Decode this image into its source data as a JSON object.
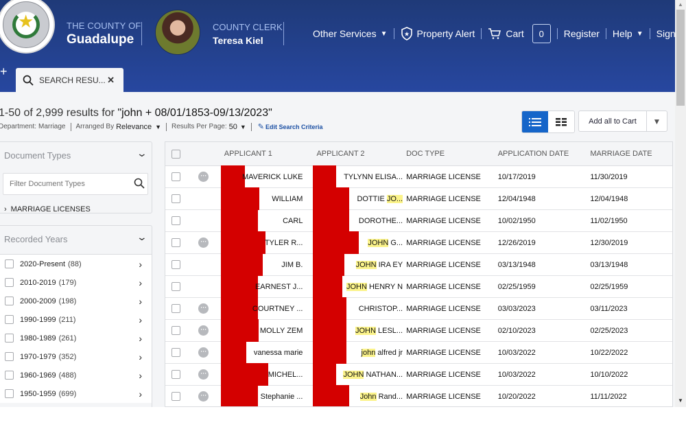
{
  "header": {
    "county_prefix": "THE COUNTY OF",
    "county_name": "Guadalupe",
    "clerk_title": "COUNTY CLERK",
    "clerk_name": "Teresa Kiel",
    "nav": {
      "other_services": "Other Services",
      "property_alert": "Property Alert",
      "cart": "Cart",
      "cart_count": "0",
      "register": "Register",
      "help": "Help",
      "sign_in": "Sign In"
    },
    "new_tab": "+",
    "tab_label": "SEARCH RESU..."
  },
  "results": {
    "summary_prefix": "1-50 of 2,999 results for",
    "query": "\"john + 08/01/1853-09/13/2023\"",
    "department_label": "Department:",
    "department_value": "Marriage",
    "arranged_label": "Arranged By",
    "arranged_value": "Relevance",
    "per_page_label": "Results Per Page:",
    "per_page_value": "50",
    "edit_criteria": "Edit Search Criteria",
    "add_all_to_cart": "Add all to Cart"
  },
  "sidebar": {
    "doc_types": {
      "title": "Document Types",
      "filter_placeholder": "Filter Document Types",
      "item": "MARRIAGE LICENSES"
    },
    "years": {
      "title": "Recorded Years",
      "items": [
        {
          "label": "2020-Present",
          "count": "(88)"
        },
        {
          "label": "2010-2019",
          "count": "(179)"
        },
        {
          "label": "2000-2009",
          "count": "(198)"
        },
        {
          "label": "1990-1999",
          "count": "(211)"
        },
        {
          "label": "1980-1989",
          "count": "(261)"
        },
        {
          "label": "1970-1979",
          "count": "(352)"
        },
        {
          "label": "1960-1969",
          "count": "(488)"
        },
        {
          "label": "1950-1959",
          "count": "(699)"
        }
      ]
    }
  },
  "table": {
    "headers": [
      "APPLICANT 1",
      "APPLICANT 2",
      "DOC TYPE",
      "APPLICATION DATE",
      "MARRIAGE DATE"
    ],
    "rows": [
      {
        "more": true,
        "a1": "MAVERICK LUKE",
        "a2_hl": "",
        "a2": "TYLYNN ELISA...",
        "doc": "MARRIAGE LICENSE",
        "app": "10/17/2019",
        "mar": "11/30/2019"
      },
      {
        "more": false,
        "a1": "WILLIAM",
        "a2_pre": "DOTTIE ",
        "a2_hl": "JO...",
        "a2": "",
        "doc": "MARRIAGE LICENSE",
        "app": "12/04/1948",
        "mar": "12/04/1948"
      },
      {
        "more": false,
        "a1": "CARL",
        "a2_hl": "",
        "a2": "DOROTHE...",
        "doc": "MARRIAGE LICENSE",
        "app": "10/02/1950",
        "mar": "11/02/1950"
      },
      {
        "more": true,
        "a1": "TYLER R...",
        "a2_hl": "JOHN",
        "a2": " G...",
        "doc": "MARRIAGE LICENSE",
        "app": "12/26/2019",
        "mar": "12/30/2019"
      },
      {
        "more": false,
        "a1": "JIM B.",
        "a2_hl": "JOHN",
        "a2": " IRA EY",
        "doc": "MARRIAGE LICENSE",
        "app": "03/13/1948",
        "mar": "03/13/1948"
      },
      {
        "more": false,
        "a1": "EARNEST J...",
        "a2_hl": "JOHN",
        "a2": " HENRY N",
        "doc": "MARRIAGE LICENSE",
        "app": "02/25/1959",
        "mar": "02/25/1959"
      },
      {
        "more": true,
        "a1": "COURTNEY ...",
        "a2_hl": "",
        "a2": "CHRISTOP...",
        "doc": "MARRIAGE LICENSE",
        "app": "03/03/2023",
        "mar": "03/11/2023"
      },
      {
        "more": true,
        "a1": "MOLLY ZEM",
        "a2_hl": "JOHN",
        "a2": " LESL...",
        "doc": "MARRIAGE LICENSE",
        "app": "02/10/2023",
        "mar": "02/25/2023"
      },
      {
        "more": true,
        "a1": "vanessa marie",
        "a2_hl": "john",
        "a2": " alfred jr",
        "doc": "MARRIAGE LICENSE",
        "app": "10/03/2022",
        "mar": "10/22/2022"
      },
      {
        "more": true,
        "a1": "MICHEL...",
        "a2_hl": "JOHN",
        "a2": " NATHAN...",
        "doc": "MARRIAGE LICENSE",
        "app": "10/03/2022",
        "mar": "10/10/2022"
      },
      {
        "more": true,
        "a1": "Stephanie ...",
        "a2_hl": "John",
        "a2": " Rand...",
        "doc": "MARRIAGE LICENSE",
        "app": "10/20/2022",
        "mar": "11/11/2022"
      }
    ]
  },
  "colors": {
    "header_bg": "#2747a0",
    "accent": "#1565c9",
    "redaction": "#d40000",
    "highlight": "#fbf38a"
  }
}
